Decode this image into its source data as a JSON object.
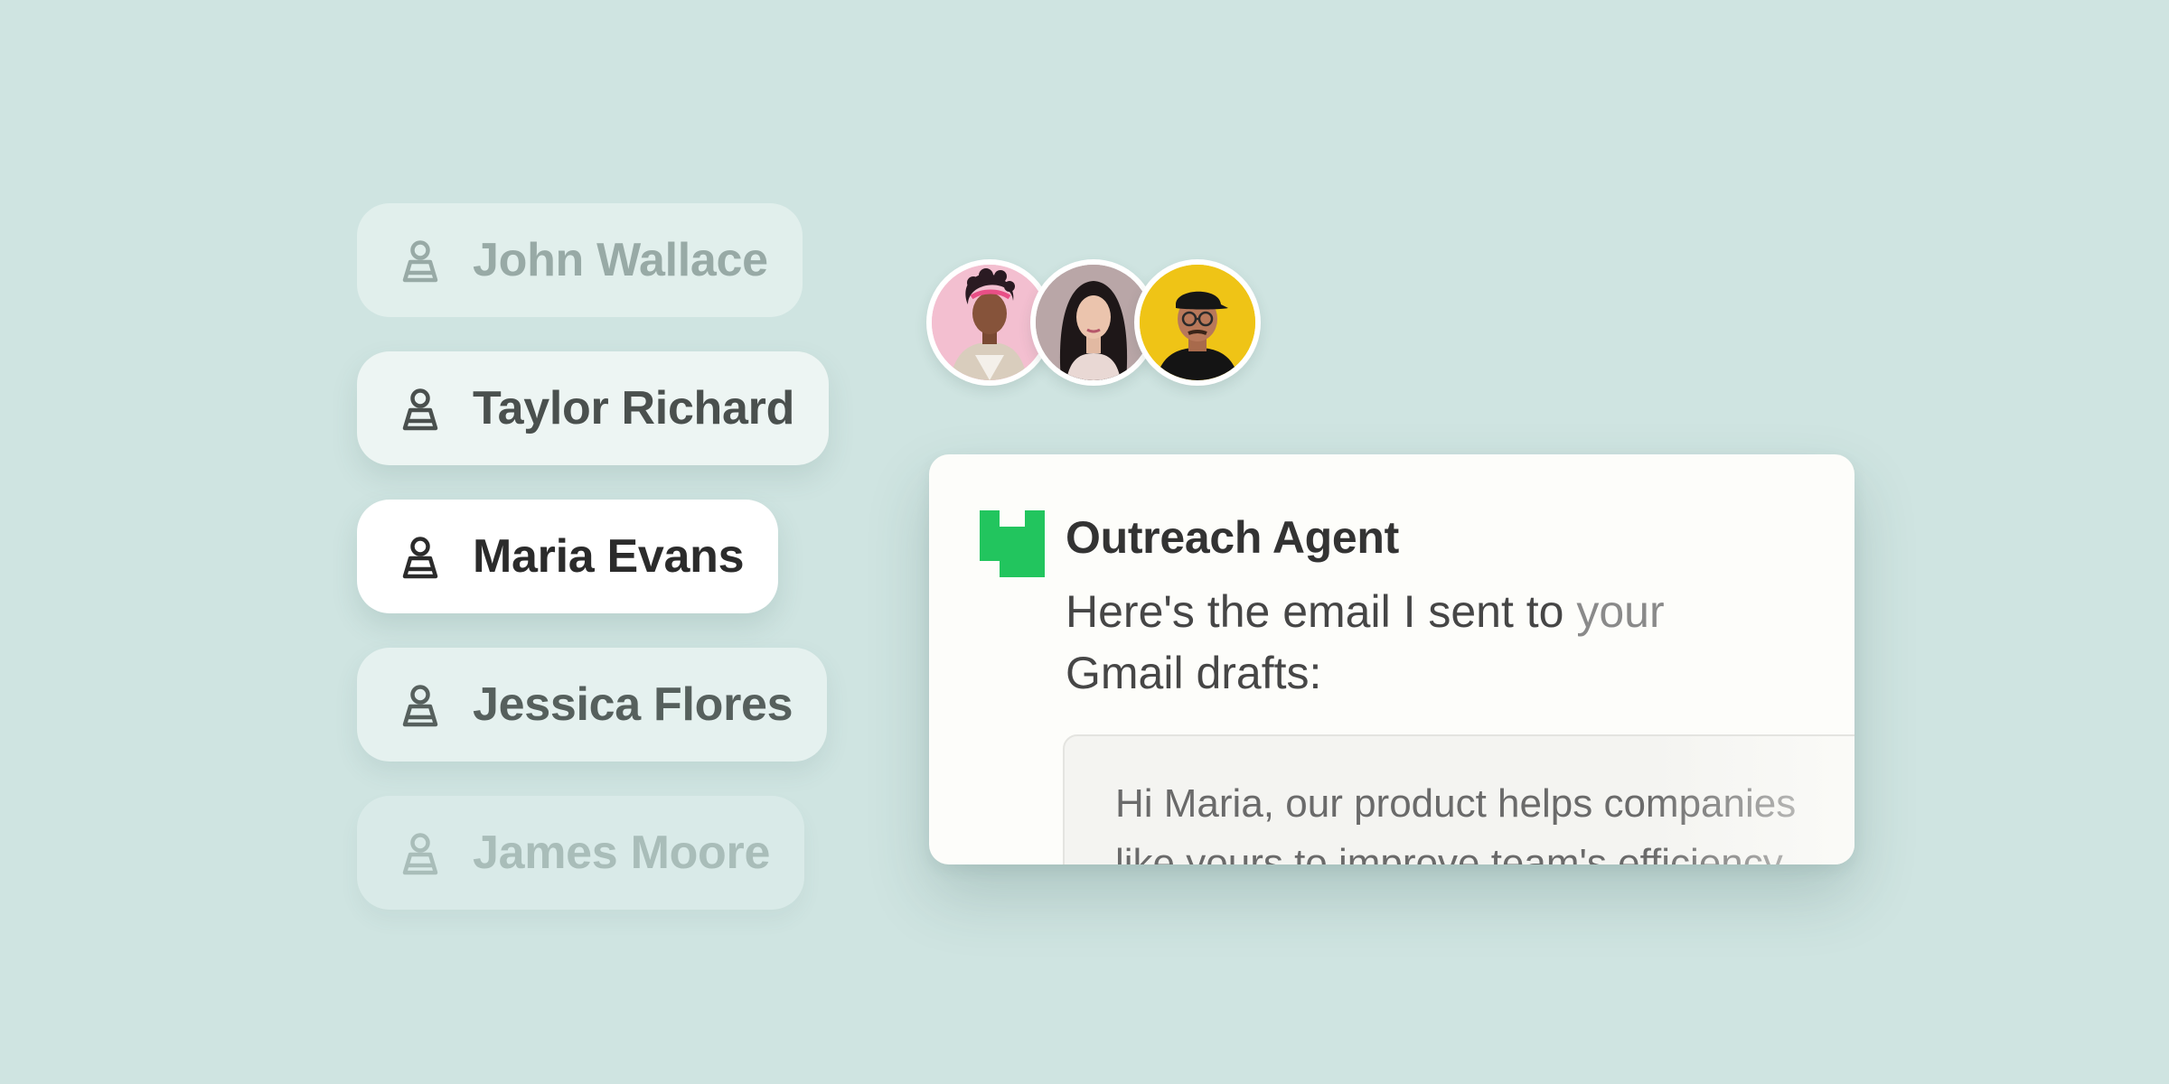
{
  "contacts": [
    {
      "name": "John Wallace",
      "icon": "person-icon"
    },
    {
      "name": "Taylor Richard",
      "icon": "person-icon"
    },
    {
      "name": "Maria Evans",
      "icon": "person-icon",
      "selected": true
    },
    {
      "name": "Jessica Flores",
      "icon": "person-icon"
    },
    {
      "name": "James Moore",
      "icon": "person-icon"
    }
  ],
  "avatars": [
    "avatar-woman-pink-background",
    "avatar-woman-dark-hair",
    "avatar-man-yellow-background"
  ],
  "card": {
    "agent_name": "Outreach Agent",
    "message_main": "Here's the email I sent to ",
    "message_faded": "your",
    "message_line2": "Gmail drafts:",
    "draft_line1": "Hi Maria, our product helps companies",
    "draft_line2": "like yours to improve team's efficiency"
  },
  "colors": {
    "background": "#cfe4e1",
    "logo_green": "#22c55e",
    "selected_card": "#ffffff"
  }
}
